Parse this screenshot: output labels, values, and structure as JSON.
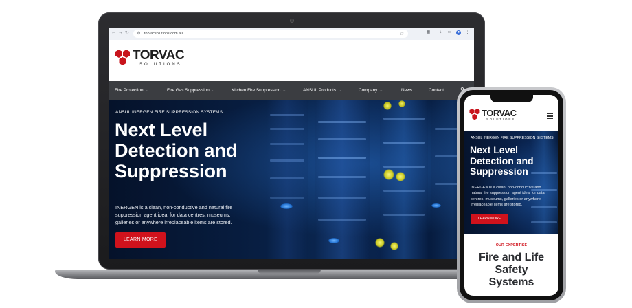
{
  "browser": {
    "url": "torvacsolutions.com.au"
  },
  "site": {
    "logo_word": "TORVAC",
    "logo_sub": "SOLUTIONS",
    "nav": [
      {
        "label": "Fire Protection",
        "has_dropdown": true
      },
      {
        "label": "Fire Gas Suppression",
        "has_dropdown": true
      },
      {
        "label": "Kitchen Fire Suppression",
        "has_dropdown": true
      },
      {
        "label": "ANSUL Products",
        "has_dropdown": true
      },
      {
        "label": "Company",
        "has_dropdown": true
      },
      {
        "label": "News",
        "has_dropdown": false
      },
      {
        "label": "Contact",
        "has_dropdown": false
      }
    ],
    "hero": {
      "eyebrow": "ANSUL INERGEN FIRE SUPPRESSION SYSTEMS",
      "title_line1": "Next Level",
      "title_line2": "Detection and",
      "title_line3": "Suppression",
      "body_line1": "INERGEN is a clean, non-conductive and natural fire",
      "body_line2": "suppression agent ideal for data centres, museums,",
      "body_line3": "galleries or anywhere irreplaceable items are stored.",
      "button": "LEARN MORE"
    }
  },
  "mobile": {
    "hero": {
      "eyebrow": "ANSUL INERGEN FIRE SUPPRESSION SYSTEMS",
      "title_line1": "Next Level",
      "title_line2": "Detection and",
      "title_line3": "Suppression",
      "body_line1": "INERGEN is a clean, non-conductive and",
      "body_line2": "natural fire suppression agent ideal for data",
      "body_line3": "centres, museums, galleries or anywhere",
      "body_line4": "irreplaceable items are stored.",
      "button": "LEARN MORE"
    },
    "expertise_label": "OUR EXPERTISE",
    "section_title_line1": "Fire and Life",
    "section_title_line2": "Safety",
    "section_title_line3": "Systems"
  },
  "colors": {
    "brand_red": "#d0121c",
    "nav_bg": "#3b3d41",
    "hero_dark": "#071c3e"
  }
}
